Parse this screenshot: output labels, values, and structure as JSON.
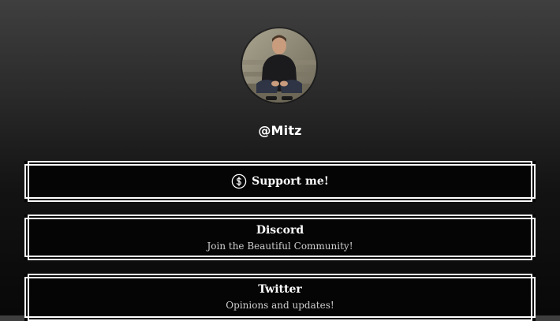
{
  "profile": {
    "username": "@Mitz"
  },
  "links": [
    {
      "title": "Support me!",
      "icon": "dollar-circle-icon"
    },
    {
      "title": "Discord",
      "subtitle": "Join the Beautiful Community!"
    },
    {
      "title": "Twitter",
      "subtitle": "Opinions and updates!"
    }
  ],
  "colors": {
    "background_top": "#3f3f3f",
    "background_bottom": "#080808",
    "button_fill": "#050505",
    "button_border": "#ffffff",
    "text": "#ffffff",
    "subtext": "#cfcfcf"
  }
}
